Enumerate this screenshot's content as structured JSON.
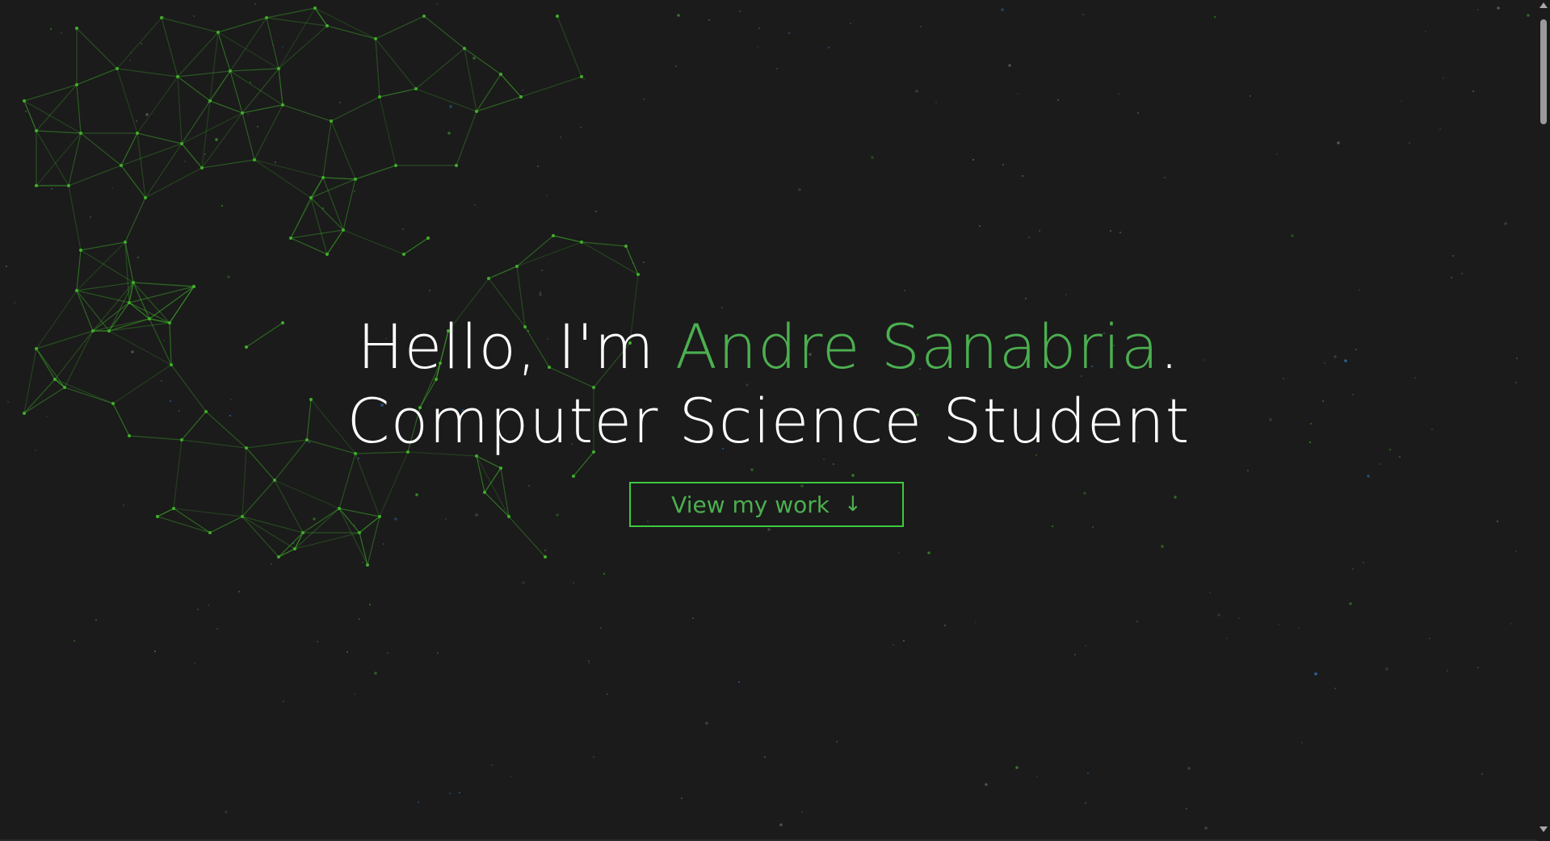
{
  "hero": {
    "greeting_prefix": "Hello, I'm ",
    "name": "Andre Sanabria",
    "greeting_suffix": ".",
    "subtitle": "Computer Science Student",
    "cta_label": "View my work",
    "cta_icon": "arrow-down-icon"
  },
  "colors": {
    "background": "#1b1b1b",
    "accent": "#4caf50",
    "button_border": "#3ec93e",
    "network_lines": "#3fae2a",
    "text": "#ffffff"
  },
  "scrollbar": {
    "up_icon": "scroll-up-arrow-icon",
    "down_icon": "scroll-down-arrow-icon"
  }
}
